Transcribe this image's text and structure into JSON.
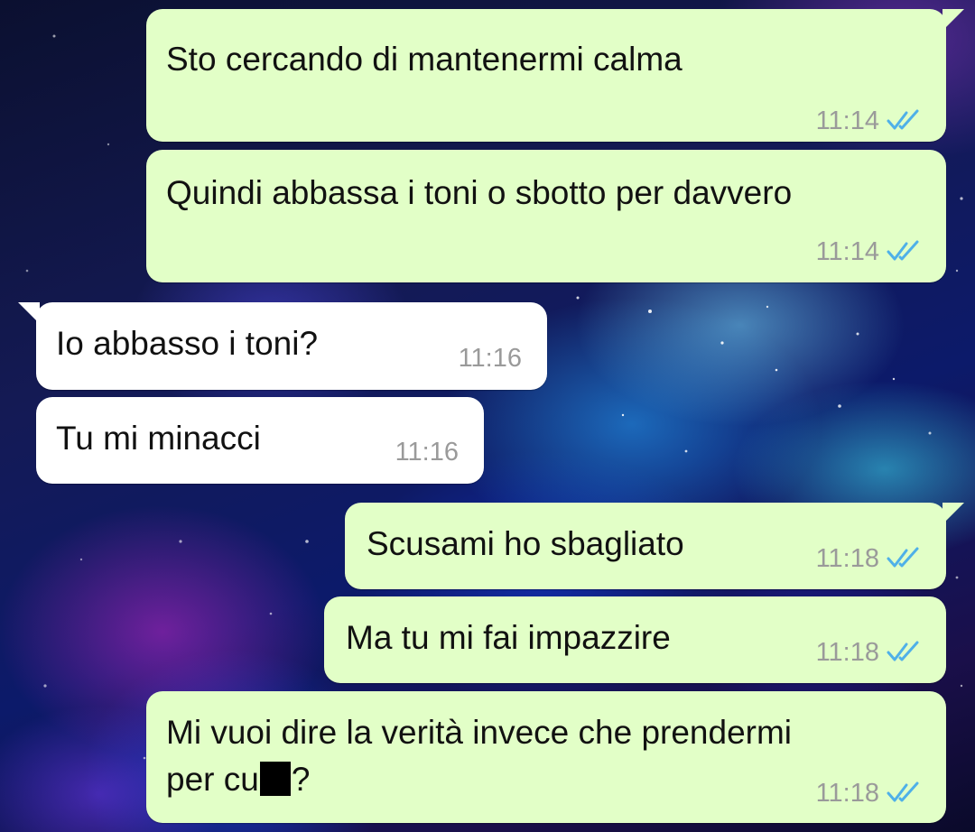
{
  "colors": {
    "outgoing_bubble": "#e2ffc7",
    "incoming_bubble": "#ffffff",
    "read_tick": "#4fb0e8",
    "timestamp": "#9a9a9a"
  },
  "messages": [
    {
      "direction": "outgoing",
      "text": "Sto cercando di mantenermi calma",
      "time": "11:14",
      "status_icon": "double-check-read-icon"
    },
    {
      "direction": "outgoing",
      "text": "Quindi abbassa i toni o sbotto per davvero",
      "time": "11:14",
      "status_icon": "double-check-read-icon"
    },
    {
      "direction": "incoming",
      "text": "Io abbasso i toni?",
      "time": "11:16"
    },
    {
      "direction": "incoming",
      "text": "Tu mi minacci",
      "time": "11:16"
    },
    {
      "direction": "outgoing",
      "text": "Scusami ho sbagliato",
      "time": "11:18",
      "status_icon": "double-check-read-icon"
    },
    {
      "direction": "outgoing",
      "text": "Ma tu mi fai impazzire",
      "time": "11:18",
      "status_icon": "double-check-read-icon"
    },
    {
      "direction": "outgoing",
      "text_line1": "Mi vuoi dire la verità invece che prendermi",
      "text_line2_before": "per cu",
      "text_line2_after": "?",
      "time": "11:18",
      "status_icon": "double-check-read-icon"
    }
  ]
}
